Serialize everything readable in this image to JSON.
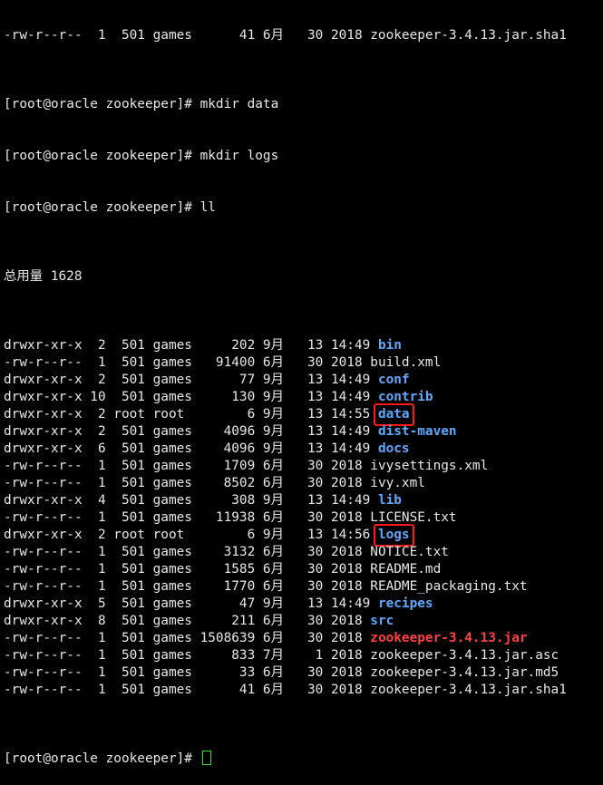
{
  "terminal": {
    "prompt": "[root@oracle zookeeper]# ",
    "top_partial_line": "-rw-r--r--  1  501 games      41 6月   30 2018 zookeeper-3.4.13.jar.sha1",
    "commands": [
      "mkdir data",
      "mkdir logs",
      "ll"
    ],
    "total_line": "总用量 1628",
    "listing": [
      {
        "meta": "drwxr-xr-x  2  501 games     202 9月   13 14:49 ",
        "name": "bin",
        "kind": "dir"
      },
      {
        "meta": "-rw-r--r--  1  501 games   91400 6月   30 2018 ",
        "name": "build.xml",
        "kind": "file"
      },
      {
        "meta": "drwxr-xr-x  2  501 games      77 9月   13 14:49 ",
        "name": "conf",
        "kind": "dir"
      },
      {
        "meta": "drwxr-xr-x 10  501 games     130 9月   13 14:49 ",
        "name": "contrib",
        "kind": "dir"
      },
      {
        "meta": "drwxr-xr-x  2 root root        6 9月   13 14:55 ",
        "name": "data",
        "kind": "dir",
        "highlighted": true
      },
      {
        "meta": "drwxr-xr-x  2  501 games    4096 9月   13 14:49 ",
        "name": "dist-maven",
        "kind": "dir"
      },
      {
        "meta": "drwxr-xr-x  6  501 games    4096 9月   13 14:49 ",
        "name": "docs",
        "kind": "dir"
      },
      {
        "meta": "-rw-r--r--  1  501 games    1709 6月   30 2018 ",
        "name": "ivysettings.xml",
        "kind": "file"
      },
      {
        "meta": "-rw-r--r--  1  501 games    8502 6月   30 2018 ",
        "name": "ivy.xml",
        "kind": "file"
      },
      {
        "meta": "drwxr-xr-x  4  501 games     308 9月   13 14:49 ",
        "name": "lib",
        "kind": "dir"
      },
      {
        "meta": "-rw-r--r--  1  501 games   11938 6月   30 2018 ",
        "name": "LICENSE.txt",
        "kind": "file"
      },
      {
        "meta": "drwxr-xr-x  2 root root        6 9月   13 14:56 ",
        "name": "logs",
        "kind": "dir",
        "highlighted": true
      },
      {
        "meta": "-rw-r--r--  1  501 games    3132 6月   30 2018 ",
        "name": "NOTICE.txt",
        "kind": "file"
      },
      {
        "meta": "-rw-r--r--  1  501 games    1585 6月   30 2018 ",
        "name": "README.md",
        "kind": "file"
      },
      {
        "meta": "-rw-r--r--  1  501 games    1770 6月   30 2018 ",
        "name": "README_packaging.txt",
        "kind": "file"
      },
      {
        "meta": "drwxr-xr-x  5  501 games      47 9月   13 14:49 ",
        "name": "recipes",
        "kind": "dir"
      },
      {
        "meta": "drwxr-xr-x  8  501 games     211 6月   30 2018 ",
        "name": "src",
        "kind": "dir"
      },
      {
        "meta": "-rw-r--r--  1  501 games 1508639 6月   30 2018 ",
        "name": "zookeeper-3.4.13.jar",
        "kind": "archive"
      },
      {
        "meta": "-rw-r--r--  1  501 games     833 7月    1 2018 ",
        "name": "zookeeper-3.4.13.jar.asc",
        "kind": "file"
      },
      {
        "meta": "-rw-r--r--  1  501 games      33 6月   30 2018 ",
        "name": "zookeeper-3.4.13.jar.md5",
        "kind": "file"
      },
      {
        "meta": "-rw-r--r--  1  501 games      41 6月   30 2018 ",
        "name": "zookeeper-3.4.13.jar.sha1",
        "kind": "file"
      }
    ],
    "colors": {
      "background": "#000000",
      "text": "#e8e8e8",
      "directory": "#5ea8ff",
      "archive": "#ff4040",
      "highlight_box": "#ff1a1a",
      "cursor": "#2ee62e"
    }
  }
}
